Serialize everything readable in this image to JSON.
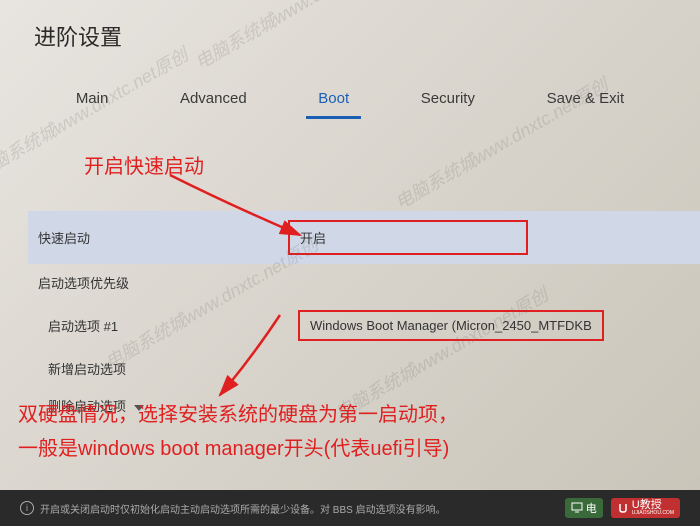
{
  "page_title": "进阶设置",
  "tabs": {
    "items": [
      {
        "label": "Main",
        "active": false
      },
      {
        "label": "Advanced",
        "active": false
      },
      {
        "label": "Boot",
        "active": true
      },
      {
        "label": "Security",
        "active": false
      },
      {
        "label": "Save & Exit",
        "active": false
      }
    ]
  },
  "annotations": {
    "tip1": "开启快速启动",
    "tip2_line1": "双硬盘情况，选择安装系统的硬盘为第一启动项，",
    "tip2_line2": "一般是windows boot manager开头(代表uefi引导)"
  },
  "settings": {
    "fast_boot": {
      "label": "快速启动",
      "value": "开启"
    },
    "boot_priority": {
      "label": "启动选项优先级"
    },
    "boot_option_1": {
      "label": "启动选项 #1",
      "value": "Windows Boot Manager (Micron_2450_MTFDKB"
    },
    "add_boot_option": {
      "label": "新增启动选项"
    },
    "remove_boot_option": {
      "label": "删除启动选项"
    }
  },
  "footer": {
    "hint": "开启或关闭启动时仅初始化启动主动启动选项所需的最少设备。对 BBS 启动选项没有影响。",
    "logo1": "电",
    "logo2": "U教授",
    "logo2_sub": "UJIAOSHOU.COM"
  },
  "watermark": "电脑系统城www.dnxtc.net原创"
}
